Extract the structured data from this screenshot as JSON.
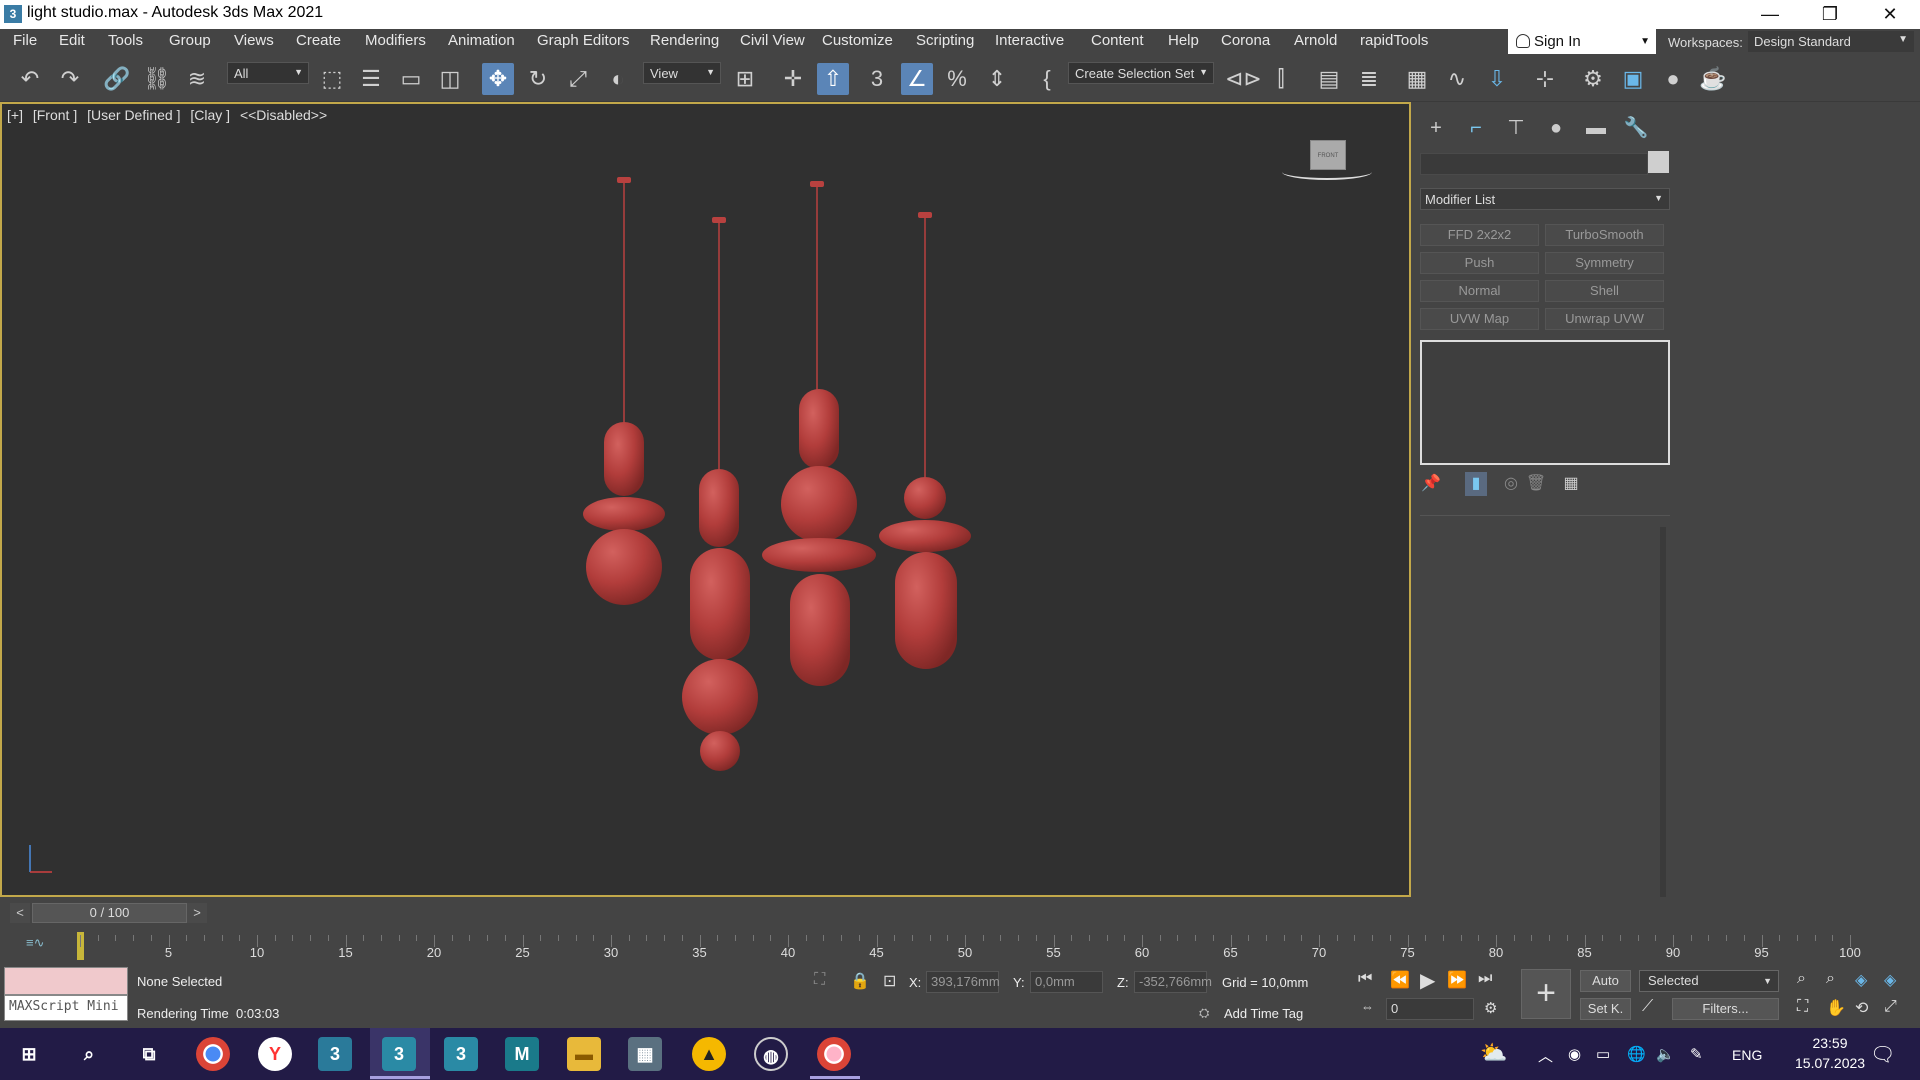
{
  "window": {
    "title": "light studio.max - Autodesk 3ds Max 2021",
    "app_icon": "3",
    "controls": [
      "minimize-icon",
      "restore-icon",
      "close-icon"
    ]
  },
  "menu": [
    "File",
    "Edit",
    "Tools",
    "Group",
    "Views",
    "Create",
    "Modifiers",
    "Animation",
    "Graph Editors",
    "Rendering",
    "Civil View",
    "Customize",
    "Scripting",
    "Interactive",
    "Content",
    "Help",
    "Corona",
    "Arnold",
    "rapidTools"
  ],
  "account": {
    "sign_in": "Sign In",
    "workspaces_label": "Workspaces:",
    "workspace": "Design Standard"
  },
  "toolbar": {
    "selection_filter": "All",
    "ref_coord": "View",
    "selection_set": "Create Selection Set"
  },
  "viewport": {
    "labels": [
      "[+]",
      "[Front ]",
      "[User Defined ]",
      "[Clay ]",
      "<<Disabled>>"
    ],
    "navcube_face": "FRONT",
    "object_color": "#b8413f"
  },
  "command_panel": {
    "modifier_list": "Modifier List",
    "modifiers": [
      "FFD 2x2x2",
      "TurboSmooth",
      "Push",
      "Symmetry",
      "Normal",
      "Shell",
      "UVW Map",
      "Unwrap UVW"
    ]
  },
  "timeline": {
    "slider": "0 / 100",
    "prev": "<",
    "next": ">",
    "ticks": [
      "5",
      "10",
      "15",
      "20",
      "25",
      "30",
      "35",
      "40",
      "45",
      "50",
      "55",
      "60",
      "65",
      "70",
      "75",
      "80",
      "85",
      "90",
      "95",
      "100"
    ],
    "current_frame": 0
  },
  "status": {
    "maxscript": "MAXScript Mini",
    "selection": "None Selected",
    "render_time_label": "Rendering Time",
    "render_time": "0:03:03",
    "x_label": "X:",
    "x_value": "393,176mm",
    "y_label": "Y:",
    "y_value": "0,0mm",
    "z_label": "Z:",
    "z_value": "-352,766mm",
    "grid": "Grid = 10,0mm",
    "add_time_tag": "Add Time Tag",
    "frame_input": "0",
    "auto": "Auto",
    "set_key": "Set K.",
    "key_filter": "Selected",
    "filters": "Filters..."
  },
  "taskbar": {
    "lang": "ENG",
    "time": "23:59",
    "date": "15.07.2023"
  }
}
